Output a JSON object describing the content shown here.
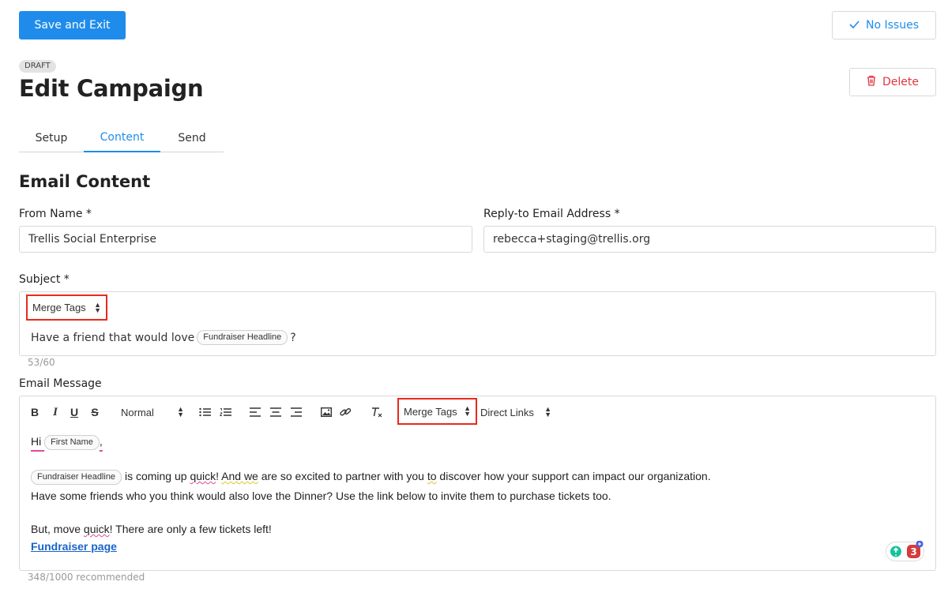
{
  "header": {
    "save_label": "Save and Exit",
    "issues_label": "No Issues",
    "delete_label": "Delete",
    "status_badge": "DRAFT",
    "title": "Edit Campaign"
  },
  "tabs": [
    {
      "label": "Setup",
      "active": false
    },
    {
      "label": "Content",
      "active": true
    },
    {
      "label": "Send",
      "active": false
    }
  ],
  "section_title": "Email Content",
  "from_name": {
    "label": "From Name *",
    "value": "Trellis Social Enterprise"
  },
  "reply_to": {
    "label": "Reply-to Email Address *",
    "value": "rebecca+staging@trellis.org"
  },
  "subject": {
    "label": "Subject *",
    "merge_tags_label": "Merge Tags",
    "text_before": "Have a friend that would love",
    "tag": "Fundraiser Headline",
    "text_after": "?",
    "counter": "53/60"
  },
  "message": {
    "label": "Email Message",
    "toolbar": {
      "bold": "B",
      "italic": "I",
      "underline": "U",
      "strike": "S",
      "format_select": "Normal",
      "merge_tags_label": "Merge Tags",
      "direct_links_label": "Direct Links"
    },
    "greeting": "Hi",
    "greeting_tag": "First Name",
    "greeting_end": ",",
    "p1_tag": "Fundraiser Headline",
    "p1_a": " is coming up ",
    "p1_b": "quick",
    "p1_c": "! ",
    "p1_d": "And we",
    "p1_e": " are so excited to partner with you ",
    "p1_f": "to",
    "p1_g": " discover how your support can impact our organization.",
    "p2": "Have some friends who you think would also love the Dinner? Use the link below to invite them to purchase tickets too.",
    "p3_a": "But, move ",
    "p3_b": "quick",
    "p3_c": "! There are only a few tickets left!",
    "link": "Fundraiser page",
    "counter": "348/1000 recommended"
  },
  "grammarly": {
    "count": "3"
  },
  "colors": {
    "primary": "#1f8ceb",
    "danger": "#e0343f",
    "highlight_box": "#e8291c",
    "link": "#1a64c8"
  }
}
